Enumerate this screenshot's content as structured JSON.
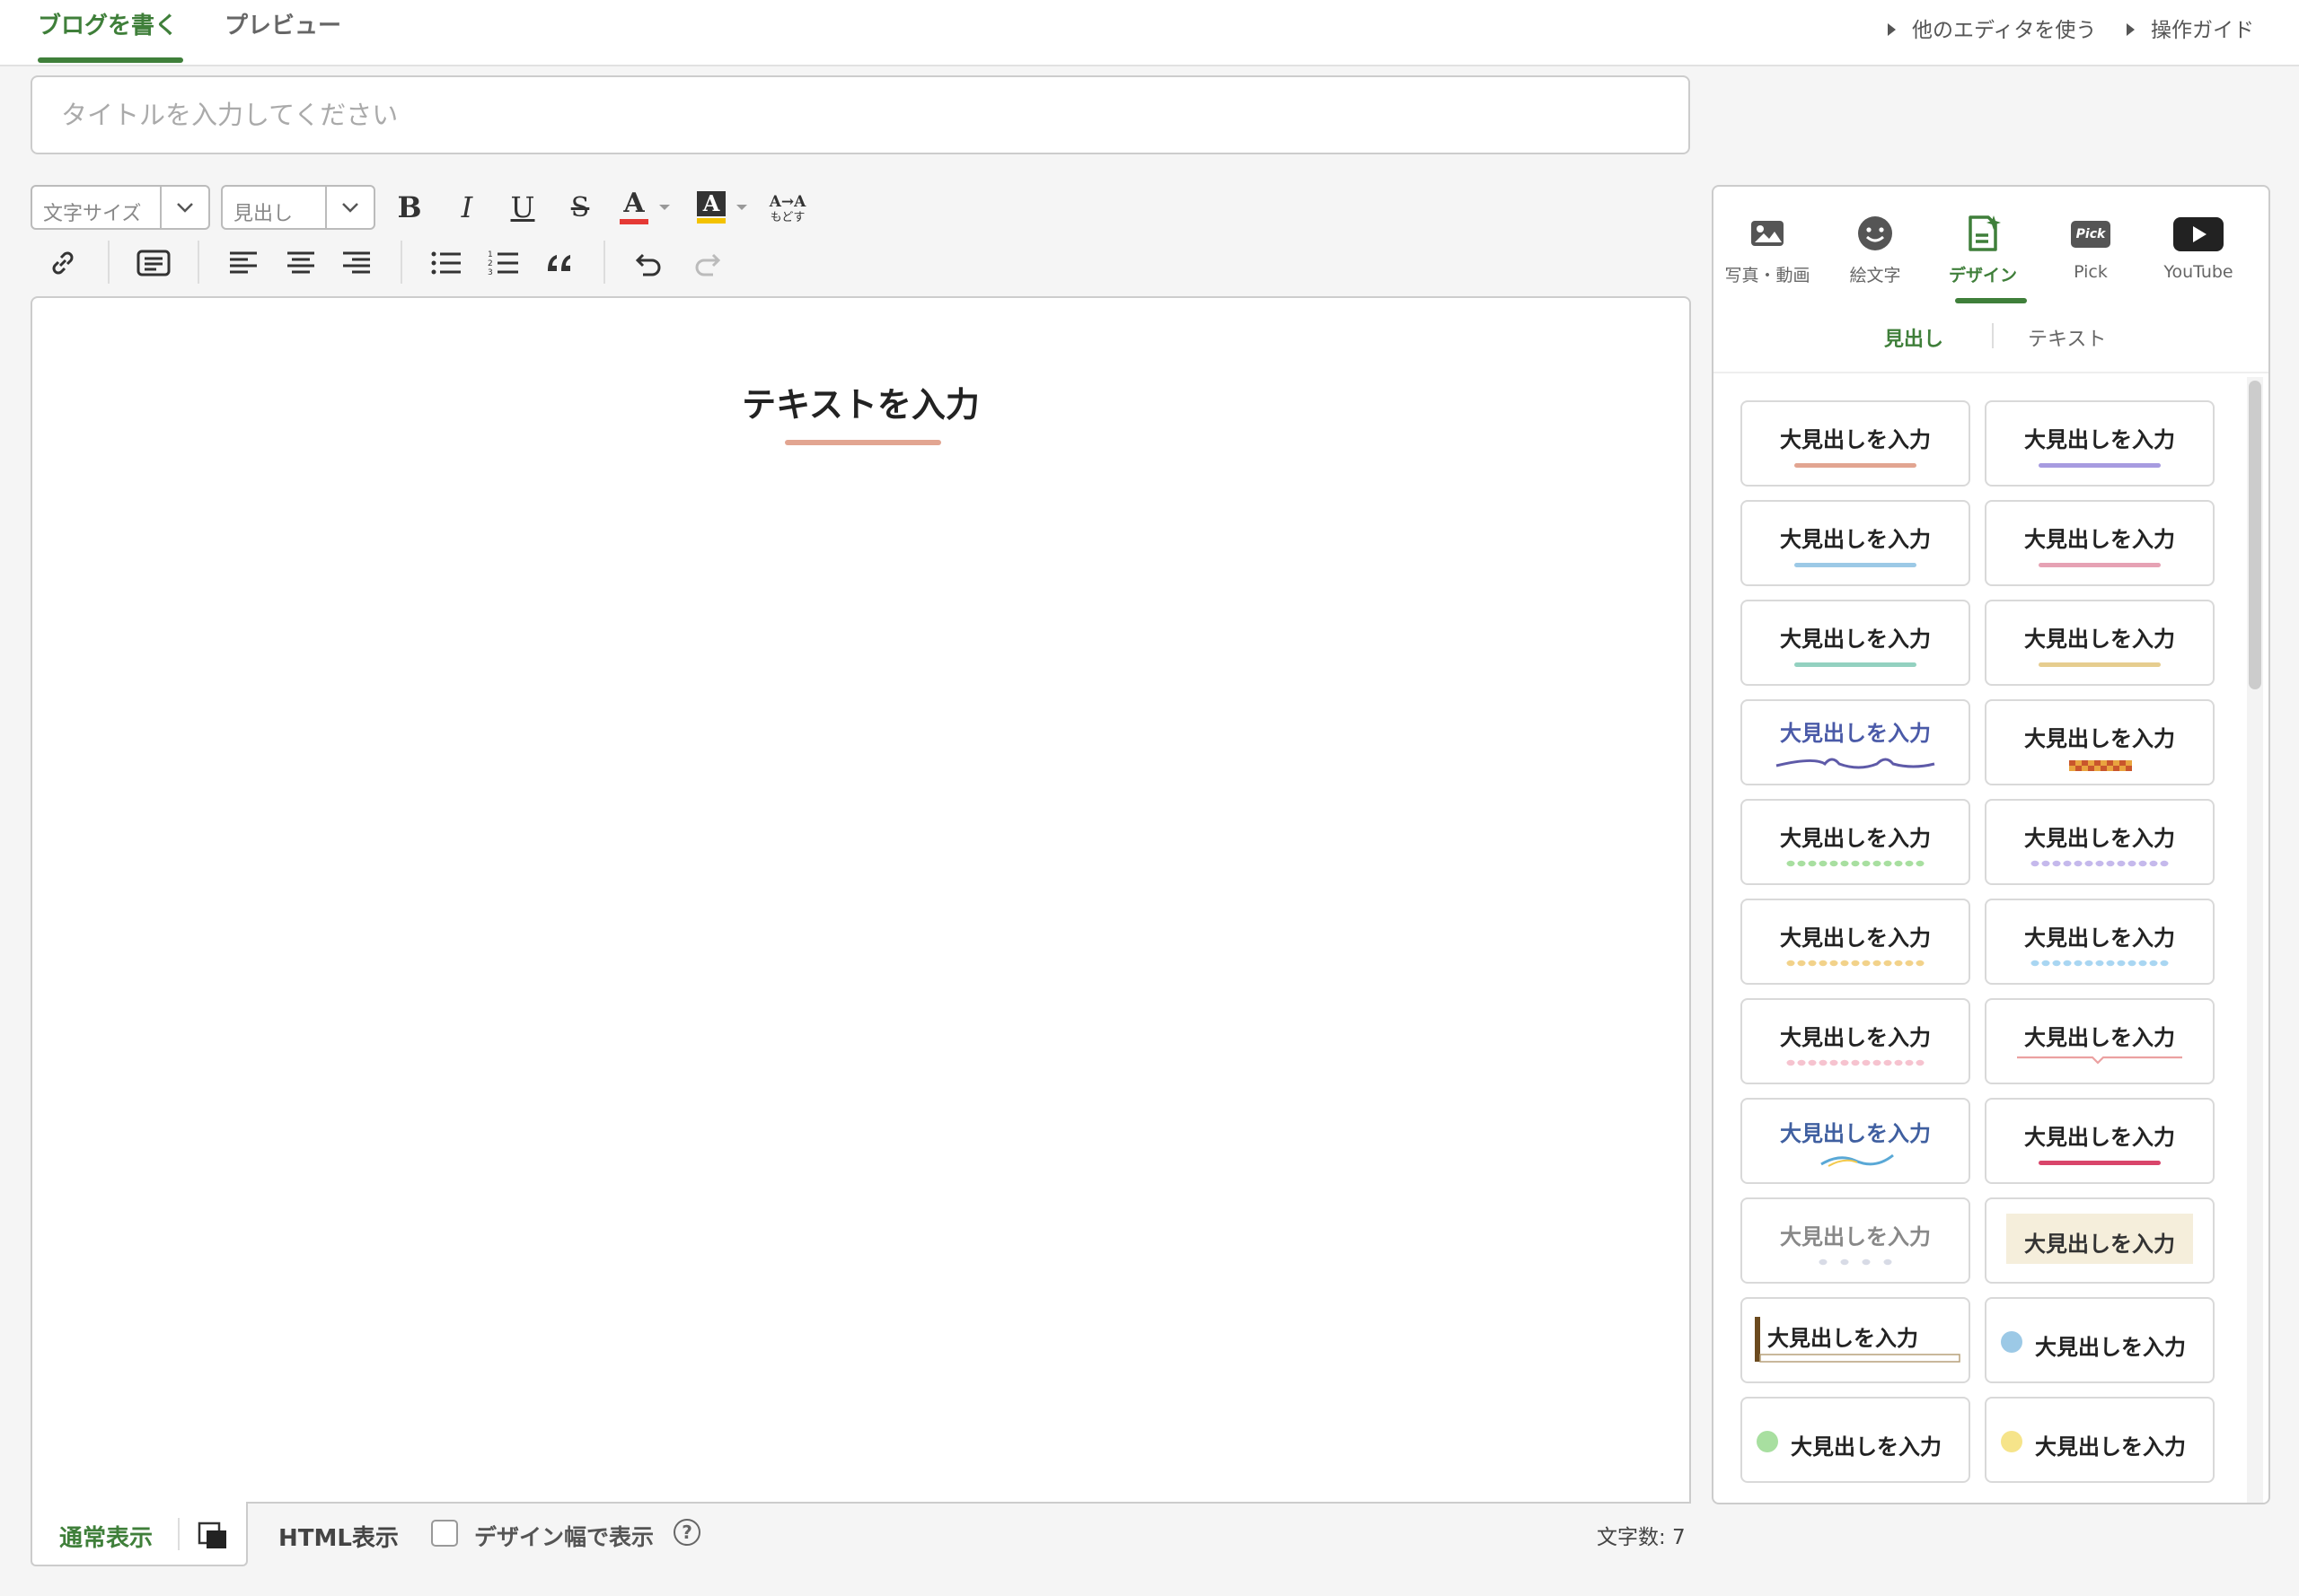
{
  "header": {
    "tabs": [
      {
        "label": "ブログを書く",
        "active": true
      },
      {
        "label": "プレビュー",
        "active": false
      }
    ],
    "links": [
      {
        "label": "他のエディタを使う"
      },
      {
        "label": "操作ガイド"
      }
    ]
  },
  "title_input": {
    "placeholder": "タイトルを入力してください",
    "value": ""
  },
  "toolbar": {
    "font_size_label": "文字サイズ",
    "heading_label": "見出し",
    "bold": "B",
    "italic": "I",
    "underline": "U",
    "strike": "S",
    "font_color": "A",
    "bg_color": "A",
    "reset_top": "A→A",
    "reset_bottom": "もどす"
  },
  "editor": {
    "heading_text": "テキストを入力",
    "accent_color": "#e2a591"
  },
  "bottom_bar": {
    "normal_mode": "通常表示",
    "html_mode": "HTML表示",
    "design_width_label": "デザイン幅で表示",
    "design_width_checked": false,
    "help": "?",
    "char_count": "文字数: 7"
  },
  "sidebar": {
    "tabs": [
      {
        "label": "写真・動画",
        "icon": "photo-icon"
      },
      {
        "label": "絵文字",
        "icon": "smiley-icon"
      },
      {
        "label": "デザイン",
        "icon": "design-icon",
        "active": true
      },
      {
        "label": "Pick",
        "icon": "pick-icon"
      },
      {
        "label": "YouTube",
        "icon": "youtube-icon"
      }
    ],
    "pick_badge": "Pick",
    "subtabs": [
      {
        "label": "見出し",
        "active": true
      },
      {
        "label": "テキスト",
        "active": false
      }
    ],
    "heading_templates": [
      {
        "text": "大見出しを入力",
        "style": "underline",
        "color": "#e2a591"
      },
      {
        "text": "大見出しを入力",
        "style": "underline",
        "color": "#a79be0"
      },
      {
        "text": "大見出しを入力",
        "style": "underline",
        "color": "#9cc9e6"
      },
      {
        "text": "大見出しを入力",
        "style": "underline",
        "color": "#e6a2b4"
      },
      {
        "text": "大見出しを入力",
        "style": "underline",
        "color": "#93d1c0"
      },
      {
        "text": "大見出しを入力",
        "style": "underline",
        "color": "#e6cd8f"
      },
      {
        "text": "大見出しを入力",
        "style": "ribbon",
        "color": "#5e5aa8"
      },
      {
        "text": "大見出しを入力",
        "style": "checker",
        "color": "#c9562c"
      },
      {
        "text": "大見出しを入力",
        "style": "dots",
        "color": "#a8dfa0"
      },
      {
        "text": "大見出しを入力",
        "style": "dots",
        "color": "#c5b9ec"
      },
      {
        "text": "大見出しを入力",
        "style": "dots",
        "color": "#f2d28a"
      },
      {
        "text": "大見出しを入力",
        "style": "dots",
        "color": "#a9d6f2"
      },
      {
        "text": "大見出しを入力",
        "style": "dots",
        "color": "#f6c3cf"
      },
      {
        "text": "大見出しを入力",
        "style": "speech-line",
        "color": "#eba1a1"
      },
      {
        "text": "大見出しを入力",
        "style": "wave",
        "color": "#59a8d6"
      },
      {
        "text": "大見出しを入力",
        "style": "underline",
        "color": "#d9456b"
      },
      {
        "text": "大見出しを入力",
        "style": "light-dots",
        "color": "#d8dbe6"
      },
      {
        "text": "大見出しを入力",
        "style": "highlight",
        "color": "#f5eedb"
      },
      {
        "text": "大見出しを入力",
        "style": "left-bar",
        "color": "#6b4a1f"
      },
      {
        "text": "大見出しを入力",
        "style": "circle",
        "color": "#9cc9e6"
      },
      {
        "text": "大見出しを入力",
        "style": "circle",
        "color": "#a8dfa0"
      },
      {
        "text": "大見出しを入力",
        "style": "circle",
        "color": "#f6e48a"
      }
    ]
  },
  "colors": {
    "accent": "#3f7f3a",
    "border": "#cccccc"
  }
}
